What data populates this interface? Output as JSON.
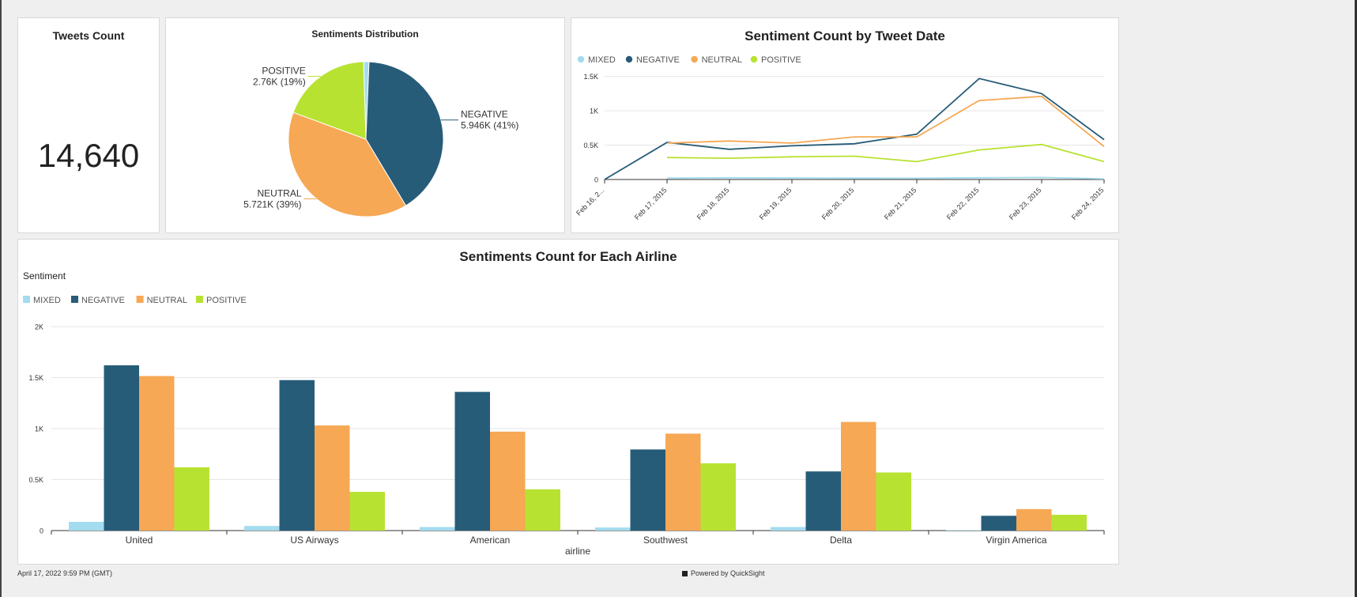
{
  "kpi": {
    "title": "Tweets Count",
    "value": "14,640"
  },
  "colors": {
    "MIXED": "#a3dcef",
    "NEGATIVE": "#275c79",
    "NEUTRAL": "#f6a854",
    "POSITIVE": "#b8e232"
  },
  "chart_data": [
    {
      "type": "pie",
      "title": "Sentiments Distribution",
      "slices": [
        {
          "name": "MIXED",
          "value": 0.163,
          "color": "#a3dcef"
        },
        {
          "name": "NEGATIVE",
          "value": 5.946,
          "color": "#275c79",
          "label1": "NEGATIVE",
          "label2": "5.946K (41%)"
        },
        {
          "name": "NEUTRAL",
          "value": 5.721,
          "color": "#f6a854",
          "label1": "NEUTRAL",
          "label2": "5.721K (39%)"
        },
        {
          "name": "POSITIVE",
          "value": 2.76,
          "color": "#b8e232",
          "label1": "POSITIVE",
          "label2": "2.76K (19%)"
        }
      ]
    },
    {
      "type": "line",
      "title": "Sentiment Count by Tweet Date",
      "legend": [
        "MIXED",
        "NEGATIVE",
        "NEUTRAL",
        "POSITIVE"
      ],
      "x": [
        "Feb 16, 2...",
        "Feb 17, 2015",
        "Feb 18, 2015",
        "Feb 19, 2015",
        "Feb 20, 2015",
        "Feb 21, 2015",
        "Feb 22, 2015",
        "Feb 23, 2015",
        "Feb 24, 2015"
      ],
      "yticks": [
        0,
        500,
        1000,
        1500
      ],
      "ytick_labels": [
        "0",
        "0.5K",
        "1K",
        "1.5K"
      ],
      "ylim": [
        0,
        1500
      ],
      "series": [
        {
          "name": "MIXED",
          "values": [
            null,
            20,
            25,
            22,
            20,
            18,
            25,
            30,
            10
          ]
        },
        {
          "name": "NEGATIVE",
          "values": [
            0,
            540,
            440,
            490,
            520,
            660,
            1470,
            1250,
            580
          ]
        },
        {
          "name": "NEUTRAL",
          "values": [
            null,
            530,
            560,
            530,
            620,
            620,
            1150,
            1210,
            480
          ]
        },
        {
          "name": "POSITIVE",
          "values": [
            null,
            320,
            310,
            330,
            340,
            260,
            430,
            510,
            260
          ]
        }
      ]
    },
    {
      "type": "bar",
      "title": "Sentiments Count for Each Airline",
      "legend_title": "Sentiment",
      "legend": [
        "MIXED",
        "NEGATIVE",
        "NEUTRAL",
        "POSITIVE"
      ],
      "xlabel": "airline",
      "categories": [
        "United",
        "US Airways",
        "American",
        "Southwest",
        "Delta",
        "Virgin America"
      ],
      "yticks": [
        0,
        500,
        1000,
        1500,
        2000
      ],
      "ytick_labels": [
        "0",
        "0.5K",
        "1K",
        "1.5K",
        "2K"
      ],
      "ylim": [
        0,
        2000
      ],
      "series": [
        {
          "name": "MIXED",
          "values": [
            85,
            45,
            35,
            30,
            35,
            5
          ]
        },
        {
          "name": "NEGATIVE",
          "values": [
            1620,
            1475,
            1360,
            795,
            580,
            145
          ]
        },
        {
          "name": "NEUTRAL",
          "values": [
            1515,
            1030,
            970,
            950,
            1065,
            210
          ]
        },
        {
          "name": "POSITIVE",
          "values": [
            620,
            380,
            405,
            660,
            570,
            155
          ]
        }
      ]
    }
  ],
  "footer": {
    "timestamp": "April 17, 2022 9:59 PM (GMT)",
    "powered": "Powered by QuickSight"
  }
}
